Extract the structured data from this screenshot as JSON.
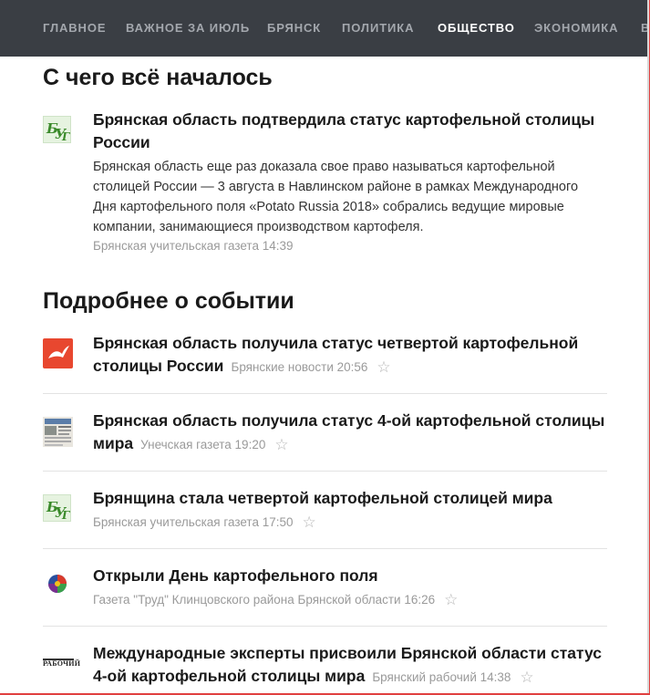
{
  "nav": {
    "tabs": [
      {
        "label": "ГЛАВНОЕ"
      },
      {
        "label": "ВАЖНОЕ ЗА ИЮЛЬ"
      },
      {
        "label": "БРЯНСК"
      },
      {
        "label": "ПОЛИТИКА"
      },
      {
        "label": "ОБЩЕСТВО"
      },
      {
        "label": "ЭКОНОМИКА"
      },
      {
        "label": "В"
      }
    ],
    "active_tab": "ОБЩЕСТВО"
  },
  "origin": {
    "title": "С чего всё началось",
    "story": {
      "headline": "Брянская область подтвердила статус картофельной столицы России",
      "snippet": "Брянская область еще раз доказала свое право называться картофельной столицей России — 3 августа в Навлинском районе в рамках Международного Дня картофельного поля «Potato Russia 2018» собрались ведущие мировые компании, занимающиеся производством картофеля.",
      "source_time": "Брянская учительская газета 14:39",
      "icon": "bug-logo-icon"
    }
  },
  "details": {
    "title": "Подробнее о событии",
    "items": [
      {
        "headline": "Брянская область получила статус четвертой картофельной столицы России",
        "meta": "Брянские новости 20:56",
        "icon": "bird-logo-icon"
      },
      {
        "headline": "Брянская область получила статус 4-ой картофельной столицы мира",
        "meta": "Унечская газета 19:20",
        "icon": "newspaper-logo-icon"
      },
      {
        "headline": "Брянщина стала четвертой картофельной столицей мира",
        "meta": "Брянская учительская газета 17:50",
        "icon": "bug-logo-icon"
      },
      {
        "headline": "Открыли День картофельного поля",
        "meta": "Газета \"Труд\" Клинцовского района Брянской области 16:26",
        "icon": "globe-logo-icon"
      },
      {
        "headline": "Международные эксперты присвоили Брянской области статус 4-ой картофельной столицы мира",
        "meta": "Брянский рабочий 14:38",
        "icon": "rabochiy-logo-icon"
      }
    ],
    "star_glyph": "☆"
  },
  "logos": {
    "bug_text": "БУГ",
    "rabochiy_text": "РАБОЧИЙ"
  }
}
